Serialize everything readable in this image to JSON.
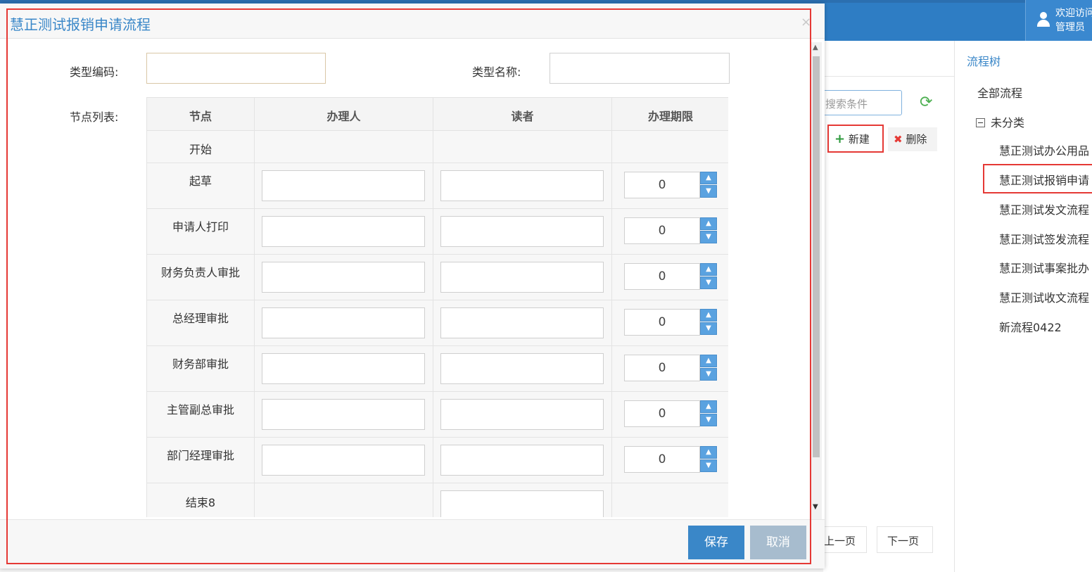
{
  "header": {
    "user_line1": "欢迎访问",
    "user_line2": "管理员"
  },
  "background": {
    "search_placeholder": "搜索条件",
    "new_button": "新建",
    "delete_button": "删除",
    "prev_page": "上一页",
    "next_page": "下一页"
  },
  "tree": {
    "title": "流程树",
    "root": "全部流程",
    "group": "未分类",
    "items": [
      "慧正测试办公用品",
      "慧正测试报销申请",
      "慧正测试发文流程",
      "慧正测试签发流程",
      "慧正测试事案批办",
      "慧正测试收文流程",
      "新流程0422"
    ]
  },
  "dialog": {
    "title": "慧正测试报销申请流程",
    "close": "×",
    "type_code_label": "类型编码:",
    "type_code_value": "",
    "type_name_label": "类型名称:",
    "type_name_value": "",
    "node_list_label": "节点列表:",
    "columns": [
      "节点",
      "办理人",
      "读者",
      "办理期限"
    ],
    "rows": [
      {
        "node": "开始",
        "deadline": ""
      },
      {
        "node": "起草",
        "deadline": "0"
      },
      {
        "node": "申请人打印",
        "deadline": "0"
      },
      {
        "node": "财务负责人审批",
        "deadline": "0"
      },
      {
        "node": "总经理审批",
        "deadline": "0"
      },
      {
        "node": "财务部审批",
        "deadline": "0"
      },
      {
        "node": "主管副总审批",
        "deadline": "0"
      },
      {
        "node": "部门经理审批",
        "deadline": "0"
      },
      {
        "node": "结束8",
        "deadline": ""
      }
    ],
    "save_button": "保存",
    "cancel_button": "取消"
  },
  "colors": {
    "accent": "#3a87c8",
    "highlight_outline": "#e53935",
    "cancel_button": "#a7bcce"
  }
}
